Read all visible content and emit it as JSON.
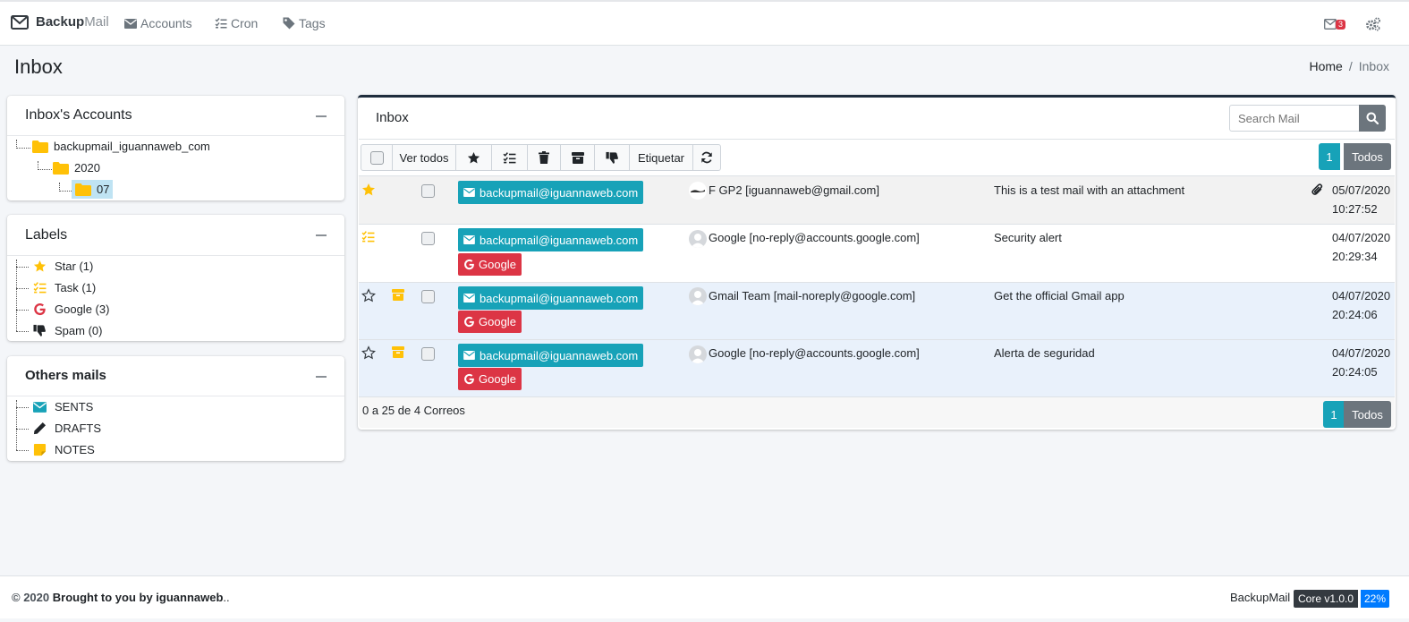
{
  "nav": {
    "brand_bold": "Backup",
    "brand_light": "Mail",
    "links": [
      "Accounts",
      "Cron",
      "Tags"
    ],
    "mail_count": "3"
  },
  "page": {
    "title": "Inbox",
    "breadcrumb": [
      "Home",
      "/",
      "Inbox"
    ]
  },
  "accounts_card": {
    "title": "Inbox's Accounts",
    "tree": [
      "backupmail_iguannaweb_com",
      "2020",
      "07"
    ]
  },
  "labels_card": {
    "title": "Labels",
    "items": [
      "Star (1)",
      "Task (1)",
      "Google (3)",
      "Spam (0)"
    ]
  },
  "others_card": {
    "title": "Others mails",
    "items": [
      "SENTS",
      "DRAFTS",
      "NOTES"
    ]
  },
  "inbox": {
    "title": "Inbox",
    "search_placeholder": "Search Mail",
    "toolbar": {
      "view_all": "Ver todos",
      "label": "Etiquetar"
    },
    "page_current": "1",
    "page_all": "Todos",
    "footer_text": "0 a 25 de 4 Correos",
    "rows": [
      {
        "account": "backupmail@iguannaweb.com",
        "tag": "",
        "from": "F GP2 [iguannaweb@gmail.com]",
        "subject": "This is a test mail with an attachment",
        "date": "05/07/2020",
        "time": "10:27:52",
        "starred": true,
        "task": false,
        "archived": false,
        "attachment": true
      },
      {
        "account": "backupmail@iguannaweb.com",
        "tag": "Google",
        "from": "Google [no-reply@accounts.google.com]",
        "subject": "Security alert",
        "date": "04/07/2020",
        "time": "20:29:34",
        "starred": false,
        "task": true,
        "archived": false,
        "attachment": false
      },
      {
        "account": "backupmail@iguannaweb.com",
        "tag": "Google",
        "from": "Gmail Team [mail-noreply@google.com]",
        "subject": "Get the official Gmail app",
        "date": "04/07/2020",
        "time": "20:24:06",
        "starred": false,
        "task": false,
        "archived": true,
        "attachment": false
      },
      {
        "account": "backupmail@iguannaweb.com",
        "tag": "Google",
        "from": "Google [no-reply@accounts.google.com]",
        "subject": "Alerta de seguridad",
        "date": "04/07/2020",
        "time": "20:24:05",
        "starred": false,
        "task": false,
        "archived": true,
        "attachment": false
      }
    ]
  },
  "footer": {
    "copyright": "© 2020",
    "credit": "Brought to you by iguannaweb",
    "credit_suffix": "..",
    "app": "BackupMail",
    "version": "Core v1.0.0",
    "percent": "22%"
  },
  "colors": {
    "teal": "#17a2b8",
    "red": "#dc3545",
    "yellow": "#ffc107",
    "dark": "#343a40",
    "row_highlight": "#e9f1fb"
  }
}
